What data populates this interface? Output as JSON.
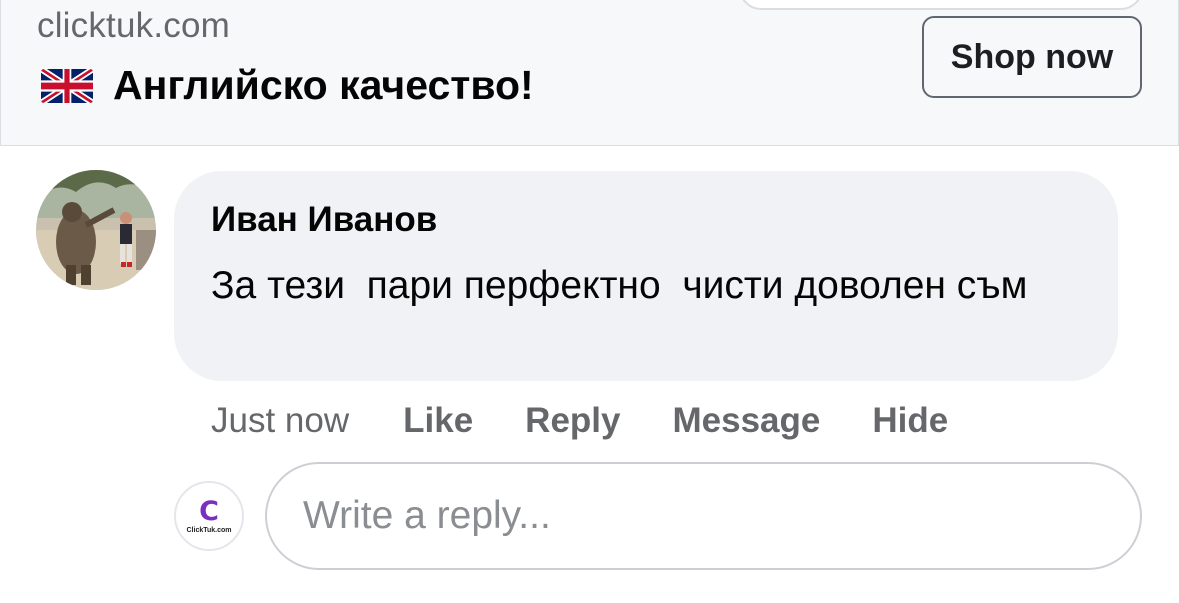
{
  "ad": {
    "domain": "clicktuk.com",
    "headline": "Английско качество!",
    "flag_icon": "uk-flag-icon",
    "cta_label": "Shop now"
  },
  "comment": {
    "author": "Иван Иванов",
    "text": "За тези  пари перфектно  чисти доволен съм",
    "avatar_icon": "user-photo-avatar",
    "time": "Just now",
    "actions": {
      "like": "Like",
      "reply": "Reply",
      "message": "Message",
      "hide": "Hide"
    }
  },
  "reply": {
    "placeholder": "Write a reply...",
    "page_avatar_letter": "C",
    "page_avatar_text": "ClickTuk.com"
  },
  "colors": {
    "secondary_text": "#65676b",
    "bubble": "#f0f2f5",
    "brand_purple": "#7b2fbe"
  }
}
